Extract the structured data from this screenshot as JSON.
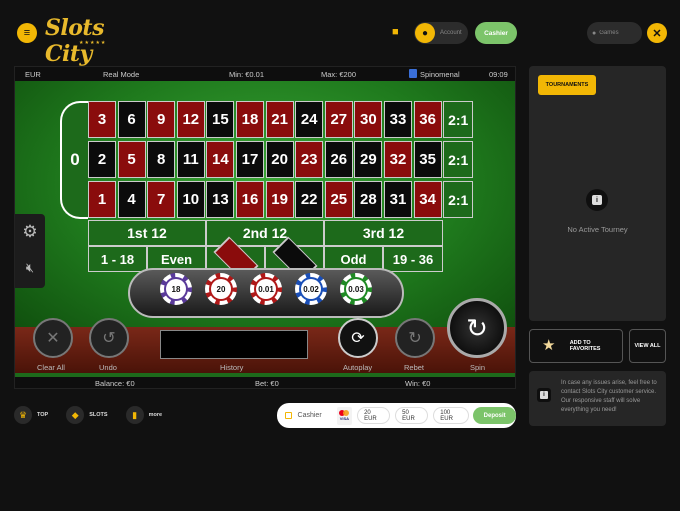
{
  "brand": {
    "logo_text": "Slots City",
    "logo_stars": "★★★★★",
    "accent": "#f2b705",
    "green": "#7cc46a"
  },
  "header": {
    "account_label": "Account",
    "cashier_label": "Cashier",
    "games_placeholder": "Games"
  },
  "game": {
    "currency": "EUR",
    "mode": "Real Mode",
    "min_bet": "Min: €0.01",
    "max_bet": "Max: €200",
    "provider": "Spinomenal",
    "time": "09:09",
    "zero": "0",
    "rows": [
      [
        {
          "n": "3",
          "c": "red"
        },
        {
          "n": "6",
          "c": "black"
        },
        {
          "n": "9",
          "c": "red"
        },
        {
          "n": "12",
          "c": "red"
        },
        {
          "n": "15",
          "c": "black"
        },
        {
          "n": "18",
          "c": "red"
        },
        {
          "n": "21",
          "c": "red"
        },
        {
          "n": "24",
          "c": "black"
        },
        {
          "n": "27",
          "c": "red"
        },
        {
          "n": "30",
          "c": "red"
        },
        {
          "n": "33",
          "c": "black"
        },
        {
          "n": "36",
          "c": "red"
        }
      ],
      [
        {
          "n": "2",
          "c": "black"
        },
        {
          "n": "5",
          "c": "red"
        },
        {
          "n": "8",
          "c": "black"
        },
        {
          "n": "11",
          "c": "black"
        },
        {
          "n": "14",
          "c": "red"
        },
        {
          "n": "17",
          "c": "black"
        },
        {
          "n": "20",
          "c": "black"
        },
        {
          "n": "23",
          "c": "red"
        },
        {
          "n": "26",
          "c": "black"
        },
        {
          "n": "29",
          "c": "black"
        },
        {
          "n": "32",
          "c": "red"
        },
        {
          "n": "35",
          "c": "black"
        }
      ],
      [
        {
          "n": "1",
          "c": "red"
        },
        {
          "n": "4",
          "c": "black"
        },
        {
          "n": "7",
          "c": "red"
        },
        {
          "n": "10",
          "c": "black"
        },
        {
          "n": "13",
          "c": "black"
        },
        {
          "n": "16",
          "c": "red"
        },
        {
          "n": "19",
          "c": "red"
        },
        {
          "n": "22",
          "c": "black"
        },
        {
          "n": "25",
          "c": "red"
        },
        {
          "n": "28",
          "c": "black"
        },
        {
          "n": "31",
          "c": "black"
        },
        {
          "n": "34",
          "c": "red"
        }
      ]
    ],
    "column_bet": "2:1",
    "dozens": [
      "1st 12",
      "2nd 12",
      "3rd 12"
    ],
    "sides": {
      "low": "1 - 18",
      "even": "Even",
      "odd": "Odd",
      "high": "19 - 36"
    },
    "chips": [
      {
        "value": "18",
        "color": "#5a3a9a"
      },
      {
        "value": "20",
        "color": "#b01818"
      },
      {
        "value": "0.01",
        "color": "#b01818"
      },
      {
        "value": "0.02",
        "color": "#1a4fb8"
      },
      {
        "value": "0.03",
        "color": "#1f8a24"
      }
    ],
    "controls": {
      "clear_all": "Clear All",
      "undo": "Undo",
      "history": "History",
      "autoplay": "Autoplay",
      "rebet": "Rebet",
      "spin": "Spin"
    },
    "footer": {
      "balance": "Balance: €0",
      "bet": "Bet: €0",
      "win": "Win: €0"
    }
  },
  "sidebar": {
    "tournaments_label": "TOURNAMENTS",
    "no_tourney": "No Active Tourney",
    "add_favorites": "ADD TO FAVORITES",
    "view_all": "VIEW ALL",
    "support_text": "In case any issues arise, feel free to contact Slots City customer service. Our responsive staff will solve everything you need!"
  },
  "bottom_nav": [
    {
      "label": "TOP",
      "icon": "crown-icon"
    },
    {
      "label": "SLOTS",
      "icon": "diamond-icon"
    },
    {
      "label": "more",
      "icon": "more-icon"
    }
  ],
  "deposit": {
    "cashier_label": "Cashier",
    "amounts": [
      "20 EUR",
      "50 EUR",
      "100 EUR"
    ],
    "deposit_label": "Deposit"
  }
}
